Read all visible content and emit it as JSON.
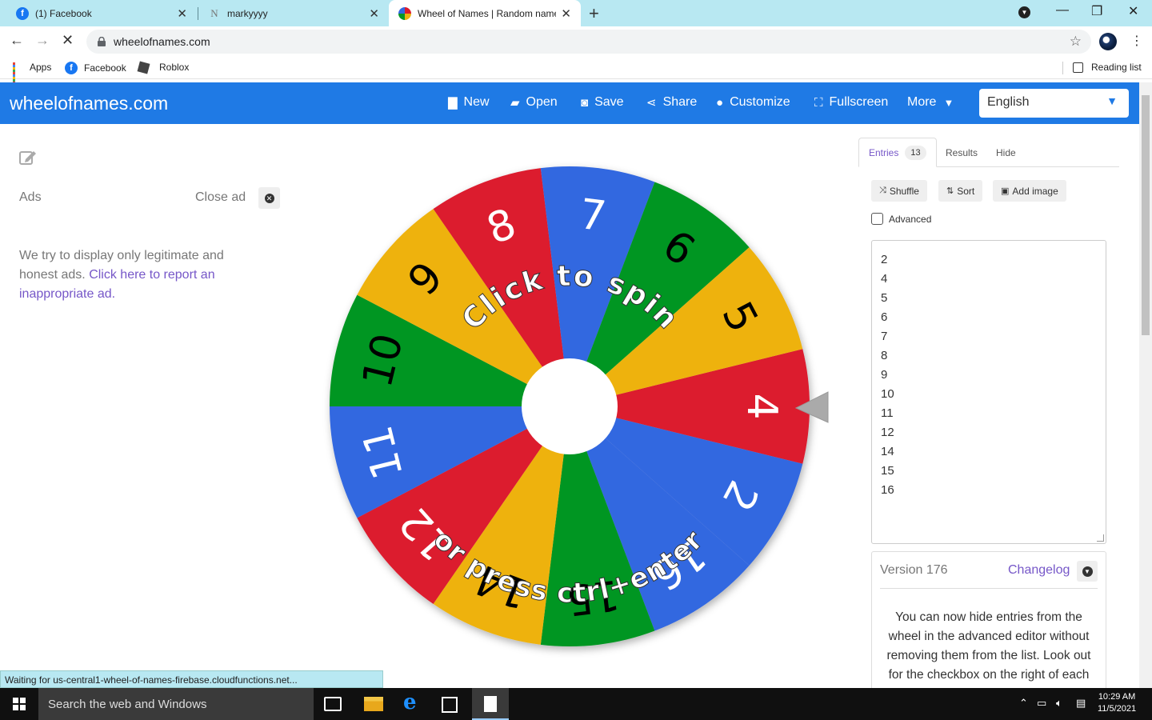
{
  "browser": {
    "tabs": [
      {
        "title": "(1) Facebook",
        "favicon": "facebook-icon"
      },
      {
        "title": "markyyyy",
        "favicon": "notion-icon"
      },
      {
        "title": "Wheel of Names | Random name",
        "favicon": "wheel-icon",
        "active": true
      }
    ],
    "url": "wheelofnames.com",
    "bookmarks": [
      {
        "label": "Apps",
        "icon": "apps-grid-icon"
      },
      {
        "label": "Facebook",
        "icon": "facebook-icon"
      },
      {
        "label": "Roblox",
        "icon": "roblox-icon"
      }
    ],
    "reading_list": "Reading list",
    "status_text": "Waiting for us-central1-wheel-of-names-firebase.cloudfunctions.net..."
  },
  "site": {
    "brand": "wheelofnames.com",
    "nav": [
      {
        "label": "New",
        "icon": "file-icon"
      },
      {
        "label": "Open",
        "icon": "folder-open-icon"
      },
      {
        "label": "Save",
        "icon": "save-icon"
      },
      {
        "label": "Share",
        "icon": "share-icon"
      },
      {
        "label": "Customize",
        "icon": "palette-icon"
      },
      {
        "label": "Fullscreen",
        "icon": "fullscreen-icon"
      },
      {
        "label": "More",
        "icon": "chevron-down-icon"
      }
    ],
    "language": "English",
    "accent_color": "#1f7ae5"
  },
  "ads": {
    "label": "Ads",
    "close_label": "Close ad",
    "text": "We try to display only legitimate and honest ads.",
    "report_link": "Click here to report an inappropriate ad."
  },
  "wheel": {
    "prompt_line1": "Click to spin",
    "prompt_line2": "or press ctrl+enter",
    "segments": [
      {
        "label": "4",
        "color": "#dc1a2e"
      },
      {
        "label": "2",
        "color": "#3367e0"
      },
      {
        "label": "16",
        "color": "#3367e0"
      },
      {
        "label": "15",
        "color": "#059624"
      },
      {
        "label": "14",
        "color": "#eeb211"
      },
      {
        "label": "12",
        "color": "#dc1a2e"
      },
      {
        "label": "11",
        "color": "#3367e0"
      },
      {
        "label": "10",
        "color": "#059624"
      },
      {
        "label": "9",
        "color": "#eeb211"
      },
      {
        "label": "8",
        "color": "#dc1a2e"
      },
      {
        "label": "7",
        "color": "#3367e0"
      },
      {
        "label": "6",
        "color": "#059624"
      },
      {
        "label": "5",
        "color": "#eeb211"
      }
    ]
  },
  "panel": {
    "tabs": {
      "entries": "Entries",
      "entries_count": "13",
      "results": "Results",
      "hide": "Hide"
    },
    "buttons": {
      "shuffle": "Shuffle",
      "sort": "Sort",
      "add_image": "Add image"
    },
    "advanced_label": "Advanced",
    "entries": [
      "2",
      "4",
      "5",
      "6",
      "7",
      "8",
      "9",
      "10",
      "11",
      "12",
      "14",
      "15",
      "16"
    ],
    "version": "Version 176",
    "changelog": "Changelog",
    "changelog_text": "You can now hide entries from the wheel in the advanced editor without removing them from the list. Look out for the checkbox on the right of each"
  },
  "taskbar": {
    "search_placeholder": "Search the web and Windows",
    "time": "10:29 AM",
    "date": "11/5/2021"
  }
}
